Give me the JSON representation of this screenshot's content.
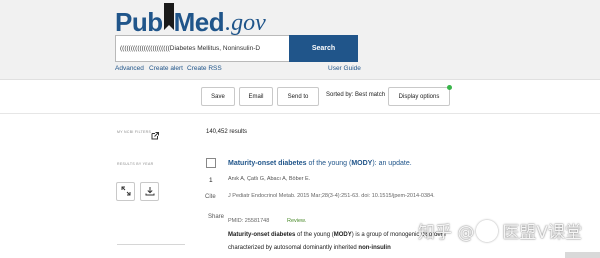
{
  "header": {
    "logo_pub": "Pub",
    "logo_med": "Med",
    "logo_gov": ".gov",
    "search_value": "(((((((((((((((((((((((Diabetes Mellitus, Noninsulin-D",
    "search_button": "Search",
    "links": {
      "advanced": "Advanced",
      "create_alert": "Create alert",
      "create_rss": "Create RSS",
      "user_guide": "User Guide"
    }
  },
  "toolbar": {
    "save": "Save",
    "email": "Email",
    "send_to": "Send to",
    "sorted_by": "Sorted by: Best match",
    "display_options": "Display options",
    "indicator_color": "#39b54a"
  },
  "sidebar": {
    "my_ncbi_filters": "MY NCBI FILTERS",
    "results_by_year": "RESULTS BY YEAR",
    "icons": [
      "external-link-icon",
      "expand-icon",
      "download-icon"
    ]
  },
  "results": {
    "count": "140,452 results",
    "items": [
      {
        "number": "1",
        "cite": "Cite",
        "share": "Share",
        "title_bold1": "Maturity-onset diabetes",
        "title_mid": " of the young (",
        "title_bold2": "MODY",
        "title_end": "): an update.",
        "authors": "Anık A, Çatlı G, Abacı A, Böber E.",
        "journal": "J Pediatr Endocrinol Metab. 2015 Mar;28(3-4):251-63. doi: 10.1515/jpem-2014-0384.",
        "pmid": "PMID: 25581748",
        "type": "Review.",
        "snippet_b1": "Maturity-onset diabetes",
        "snippet_t1": " of the young (",
        "snippet_b2": "MODY",
        "snippet_t2": ") is a group of monogenic disorders characterized by autosomal dominantly inherited ",
        "snippet_b3": "non-insulin"
      }
    ]
  },
  "watermark": {
    "text_a": "知乎 @",
    "text_b": "医盟V课堂"
  },
  "colors": {
    "brand": "#20558a",
    "header_bg": "#f1f1f1"
  }
}
